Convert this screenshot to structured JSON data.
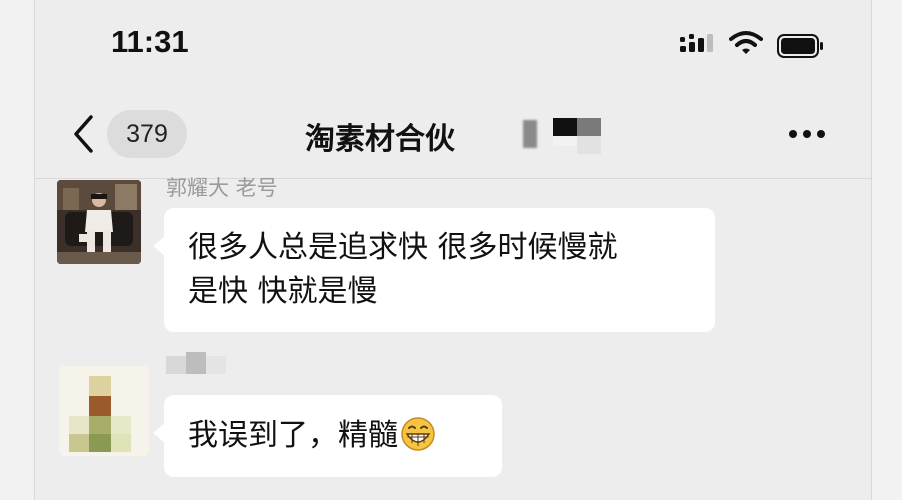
{
  "status_bar": {
    "time": "11:31",
    "icons": [
      "signal-icon",
      "wifi-icon",
      "battery-icon"
    ]
  },
  "nav": {
    "back_icon": "chevron-left-icon",
    "unread_count": "379",
    "title": "淘素材合伙",
    "more_icon": "more-horizontal-icon"
  },
  "messages": [
    {
      "sender": "郭耀大  老号",
      "text_line1": "很多人总是追求快 很多时候慢就",
      "text_line2": "是快 快就是慢"
    },
    {
      "sender": "",
      "text": "我误到了，精髓",
      "emoji": "grinning-face-icon"
    }
  ],
  "colors": {
    "chat_background": "#ededed",
    "bubble": "#ffffff",
    "sender_name": "#9a9a9a",
    "badge": "#dcdcdc"
  }
}
